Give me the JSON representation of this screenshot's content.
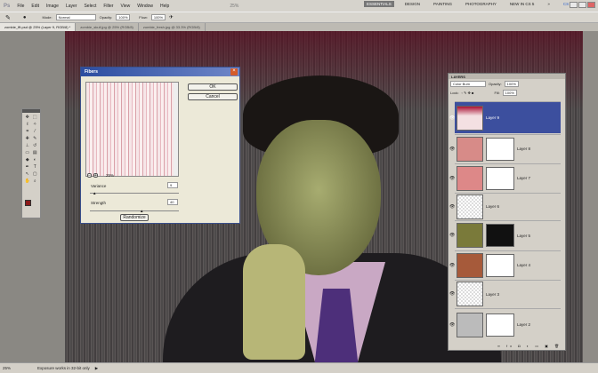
{
  "app": {
    "logo": "Ps",
    "menu": [
      "File",
      "Edit",
      "Image",
      "Layer",
      "Select",
      "Filter",
      "View",
      "Window",
      "Help"
    ],
    "zoom": "25%",
    "workspaces": [
      "ESSENTIALS",
      "DESIGN",
      "PAINTING",
      "PHOTOGRAPHY",
      "NEW IN CS 5",
      "»"
    ],
    "cslive": "CS Live"
  },
  "options": {
    "mode_label": "Mode:",
    "mode": "Normal",
    "opacity_label": "Opacity:",
    "opacity": "100%",
    "flow_label": "Flow:",
    "flow": "100%"
  },
  "tabs": [
    "zombie_fft.psd @ 25% (Layer 9, RGB/8) *",
    "zombie_skull.jpg @ 25% (RGB/8)",
    "zombie_fresh.jpg @ 33.3% (RGB/8)"
  ],
  "dialog": {
    "title": "Fibers",
    "ok": "OK",
    "cancel": "Cancel",
    "zoom": "25%",
    "variance_label": "Variance",
    "variance": "9",
    "strength_label": "Strength",
    "strength": "40",
    "randomize": "Randomize",
    "variance_pct": 0.05,
    "strength_pct": 0.58
  },
  "layers": {
    "title": "LAYERS",
    "blend": "Color Burn",
    "opacity_label": "Opacity:",
    "opacity": "100%",
    "lock_label": "Lock:",
    "fill_label": "Fill:",
    "fill": "100%",
    "items": [
      {
        "name": "Layer 9"
      },
      {
        "name": "Layer 8"
      },
      {
        "name": "Layer 7"
      },
      {
        "name": "Layer 6"
      },
      {
        "name": "Layer 5"
      },
      {
        "name": "Layer 4"
      },
      {
        "name": "Layer 3"
      },
      {
        "name": "Layer 2"
      }
    ]
  },
  "status": {
    "zoom": "25%",
    "message": "Exposure works in 32-bit only"
  },
  "colors": {
    "foreground": "#8b1a1a",
    "background": "#ffffff",
    "selection": "#3c4f9e"
  }
}
